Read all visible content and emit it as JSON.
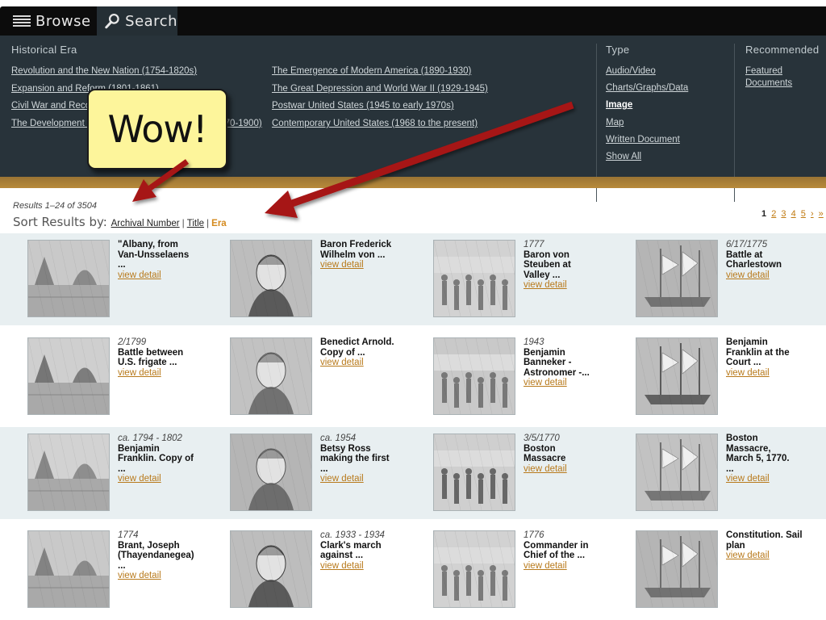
{
  "topbar": {
    "browse_label": "Browse",
    "search_label": "Search"
  },
  "panel": {
    "era_heading": "Historical Era",
    "era_col1": [
      "Revolution and the New Nation (1754-1820s)",
      "Expansion and Reform (1801-1861)",
      "Civil War and Reconstruction (1850-1877)",
      "The Development of the Industrial United States (1870-1900)"
    ],
    "era_col2": [
      "The Emergence of Modern America (1890-1930)",
      "The Great Depression and World War II (1929-1945)",
      "Postwar United States (1945 to early 1970s)",
      "Contemporary United States (1968 to the present)"
    ],
    "type_heading": "Type",
    "types": [
      "Audio/Video",
      "Charts/Graphs/Data",
      "Image",
      "Map",
      "Written Document",
      "Show All"
    ],
    "selected_type": "Image",
    "recommended_heading": "Recommended",
    "recommended_line1": "Featured",
    "recommended_line2": "Documents"
  },
  "annotation": {
    "text": "Wow!"
  },
  "results": {
    "count": "Results 1–24 of 3504",
    "sort_label": "Sort Results by:",
    "sort_archival": "Archival Number",
    "sort_title": "Title",
    "sort_era": "Era",
    "separator": "|",
    "current_page": "1",
    "pages": [
      "2",
      "3",
      "4",
      "5"
    ],
    "next": "›",
    "last": "»"
  },
  "view_detail": "view detail",
  "items": [
    [
      {
        "date": "",
        "title": [
          "\"Albany, from",
          "Van-Unsselaens",
          "..."
        ]
      },
      {
        "date": "",
        "title": [
          "Baron Frederick",
          "Wilhelm von ..."
        ]
      },
      {
        "date": "1777",
        "title": [
          "Baron von",
          "Steuben at",
          "Valley ..."
        ]
      },
      {
        "date": "6/17/1775",
        "title": [
          "Battle at",
          "Charlestown"
        ]
      }
    ],
    [
      {
        "date": "2/1799",
        "title": [
          "Battle between",
          "U.S. frigate ..."
        ]
      },
      {
        "date": "",
        "title": [
          "Benedict Arnold.",
          "Copy of ..."
        ]
      },
      {
        "date": "1943",
        "title": [
          "Benjamin",
          "Banneker -",
          "Astronomer -..."
        ]
      },
      {
        "date": "",
        "title": [
          "Benjamin",
          "Franklin at the",
          "Court ..."
        ]
      }
    ],
    [
      {
        "date": "ca. 1794 - 1802",
        "title": [
          "Benjamin",
          "Franklin. Copy of",
          "..."
        ]
      },
      {
        "date": "ca. 1954",
        "title": [
          "Betsy Ross",
          "making the first",
          "..."
        ]
      },
      {
        "date": "3/5/1770",
        "title": [
          "Boston",
          "Massacre"
        ]
      },
      {
        "date": "",
        "title": [
          "Boston",
          "Massacre,",
          "March 5, 1770.",
          "..."
        ]
      }
    ],
    [
      {
        "date": "1774",
        "title": [
          "Brant, Joseph",
          "(Thayendanegea)",
          "..."
        ]
      },
      {
        "date": "ca. 1933 - 1934",
        "title": [
          "Clark's march",
          "against ..."
        ]
      },
      {
        "date": "1776",
        "title": [
          "Commander in",
          "Chief of the ..."
        ]
      },
      {
        "date": "",
        "title": [
          "Constitution. Sail",
          "plan"
        ]
      }
    ]
  ]
}
